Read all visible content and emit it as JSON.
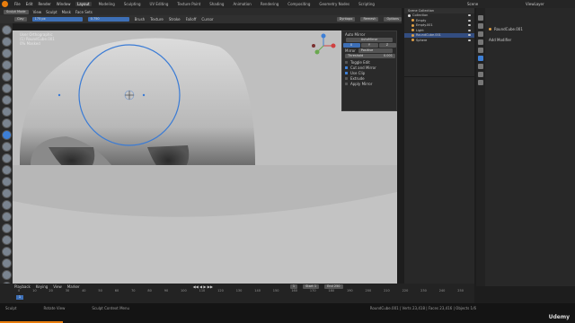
{
  "app": {
    "menu": [
      "File",
      "Edit",
      "Render",
      "Window",
      "Help"
    ],
    "workspaces": [
      "Layout",
      "Modeling",
      "Sculpting",
      "UV Editing",
      "Texture Paint",
      "Shading",
      "Animation",
      "Rendering",
      "Compositing",
      "Geometry Nodes",
      "Scripting"
    ],
    "active_workspace": "Layout",
    "scene": "Scene",
    "view_layer": "ViewLayer"
  },
  "header": {
    "mode": "Sculpt Mode",
    "menus": [
      "View",
      "Sculpt",
      "Mask",
      "Face Sets"
    ],
    "brush_name": "Clay",
    "radius": "175 px",
    "strength": "0.750",
    "tool_menus": [
      "Brush",
      "Texture",
      "Stroke",
      "Falloff",
      "Cursor"
    ],
    "right_buttons": [
      "Dyntopo",
      "Remesh",
      "Options"
    ]
  },
  "viewport": {
    "info": [
      "User Orthographic",
      "(1) RoundCube.001",
      "0% Masked"
    ]
  },
  "symmetry_panel": {
    "title": "Auto Mirror",
    "auto_mirror_btn": "AutoMirror",
    "axes": [
      "X",
      "Y",
      "Z"
    ],
    "mirror_label": "Mirror",
    "mirror_value": "Positive",
    "threshold_label": "Threshold",
    "threshold_value": "0.001",
    "options": [
      {
        "label": "Toggle Edit",
        "checked": false
      },
      {
        "label": "Cut and Mirror",
        "checked": true
      },
      {
        "label": "Use Clip",
        "checked": true
      },
      {
        "label": "Extrude",
        "checked": false
      },
      {
        "label": "Apply Mirror",
        "checked": false
      }
    ]
  },
  "outliner": {
    "title": "Scene Collection",
    "items": [
      {
        "label": "Collection",
        "selected": false
      },
      {
        "label": "Empty",
        "selected": false
      },
      {
        "label": "Empty.001",
        "selected": false
      },
      {
        "label": "Light",
        "selected": false
      },
      {
        "label": "RoundCube.001",
        "selected": true
      },
      {
        "label": "Sphere",
        "selected": false
      }
    ]
  },
  "properties": {
    "object_name": "RoundCube.001",
    "add_modifier": "Add Modifier"
  },
  "timeline": {
    "menus": [
      "Playback",
      "Keying",
      "View",
      "Marker"
    ],
    "start_label": "Start",
    "start_value": "1",
    "end_label": "End",
    "end_value": "250",
    "current_frame": "1",
    "frames": [
      "0",
      "10",
      "20",
      "30",
      "40",
      "50",
      "60",
      "70",
      "80",
      "90",
      "100",
      "110",
      "120",
      "130",
      "140",
      "150",
      "160",
      "170",
      "180",
      "190",
      "200",
      "210",
      "220",
      "230",
      "240",
      "250"
    ]
  },
  "status": {
    "left": "Sculpt",
    "middle1": "Rotate View",
    "middle2": "Sculpt Context Menu",
    "right": "RoundCube.001 | Verts 23,418 | Faces 23,416 | Objects 1/6"
  },
  "watermark": "Udemy",
  "colors": {
    "accent": "#3d7fd6",
    "brand": "#e87d0d"
  }
}
